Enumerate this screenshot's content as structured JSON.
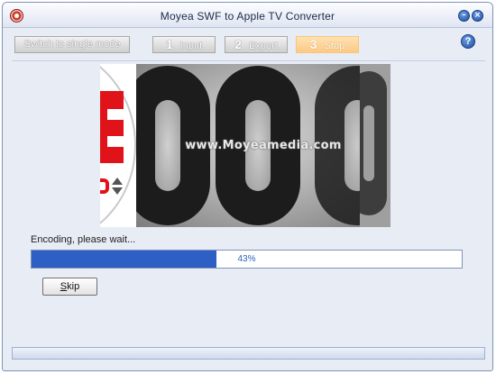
{
  "window": {
    "title": "Moyea SWF to Apple TV Converter",
    "minimize_glyph": "–",
    "close_glyph": "×"
  },
  "toolbar": {
    "switch_label": "Switch to single mode",
    "steps": [
      {
        "num": "1",
        "label": "Input",
        "state": "disabled"
      },
      {
        "num": "2",
        "label": "Export",
        "state": "disabled"
      },
      {
        "num": "3",
        "label": "Stop",
        "state": "active"
      }
    ],
    "help_glyph": "?"
  },
  "preview": {
    "watermark": "www.Moyeamedia.com",
    "icons": [
      "countdown-digit-icon",
      "up-down-arrow-icon"
    ]
  },
  "encoding": {
    "status_text": "Encoding, please wait...",
    "progress_fraction": 0.43,
    "progress_text": "43%"
  },
  "skip_button": {
    "label_underlined": "S",
    "label_rest": "kip"
  },
  "colors": {
    "accent": "#2e5fc4",
    "stop_button": "#fdc985",
    "window_bg": "#e8ecf5"
  }
}
